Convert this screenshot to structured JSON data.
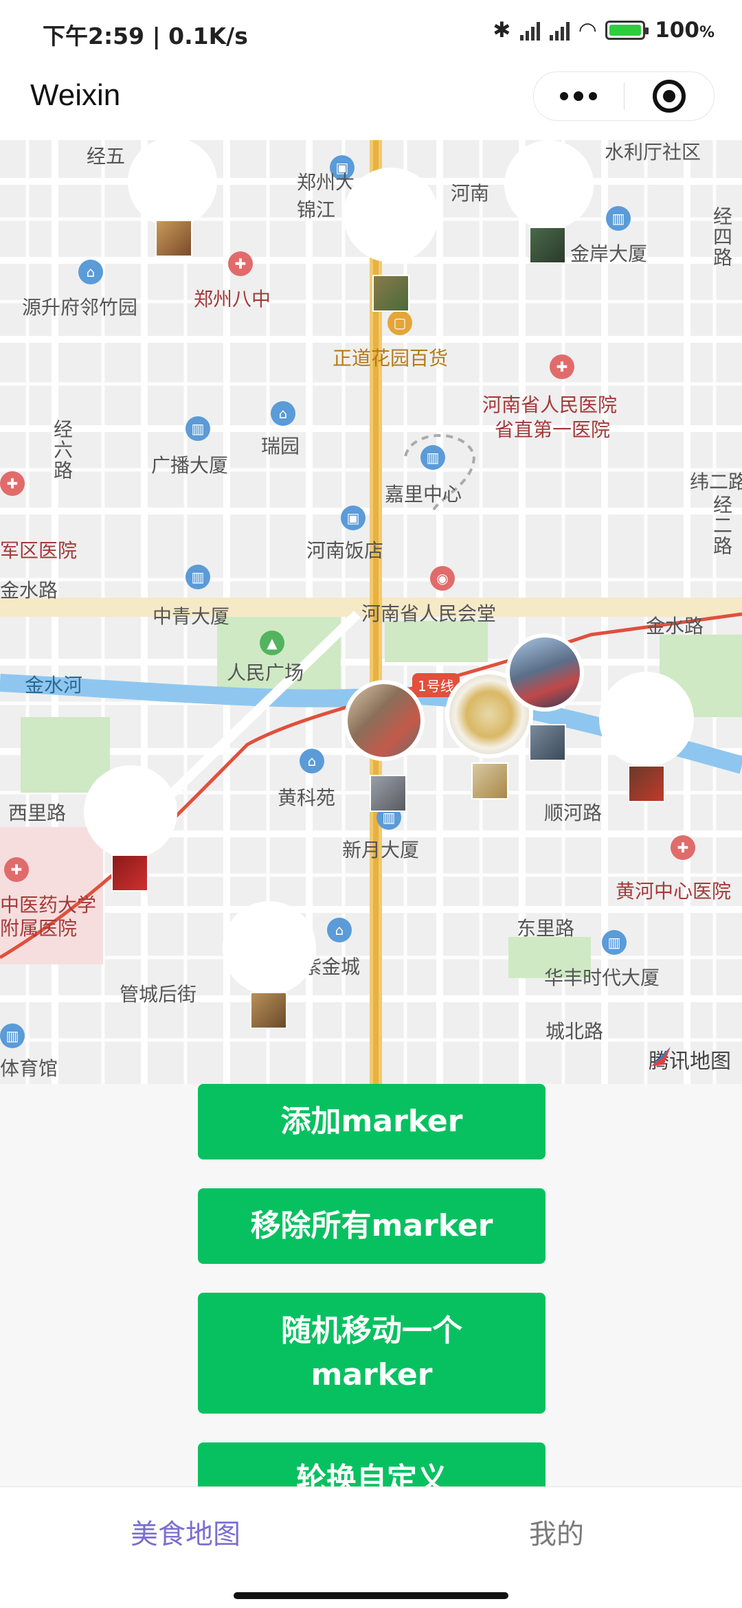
{
  "status_bar": {
    "left_text": "下午2:59 | 0.1K/s",
    "battery": "100",
    "battery_unit": "%"
  },
  "app": {
    "title": "Weixin"
  },
  "map": {
    "provider_logo": "腾讯地图",
    "metro_badge": "1号线",
    "labels": [
      "经五",
      "郑州大",
      "锦江",
      "河南",
      "水利厅社区",
      "金岸大厦",
      "郑州八中",
      "源升府邻竹园",
      "正道花园百货",
      "河南省人民医院",
      "省直第一医院",
      "广播大厦",
      "瑞园",
      "嘉里中心",
      "军区医院",
      "河南饭店",
      "金水路",
      "中青大厦",
      "河南省人民会堂",
      "金水路",
      "人民广场",
      "金水河",
      "黄科苑",
      "西里路",
      "顺河路",
      "新月大厦",
      "中医药大学",
      "附属医院",
      "黄河中心医院",
      "东里路",
      "紫金城",
      "华丰时代大厦",
      "管城后街",
      "城北路",
      "体育馆",
      "经六路",
      "纬二路",
      "经四路",
      "经二路"
    ]
  },
  "buttons": {
    "add_marker": "添加marker",
    "remove_all": "移除所有marker",
    "random_move": "随机移动一个marker",
    "rotate_custom": "轮换自定义"
  },
  "tabs": [
    {
      "label": "美食地图",
      "active": true
    },
    {
      "label": "我的",
      "active": false
    }
  ],
  "colors": {
    "primary_button": "#07c160",
    "active_tab": "#7b6fd1"
  }
}
